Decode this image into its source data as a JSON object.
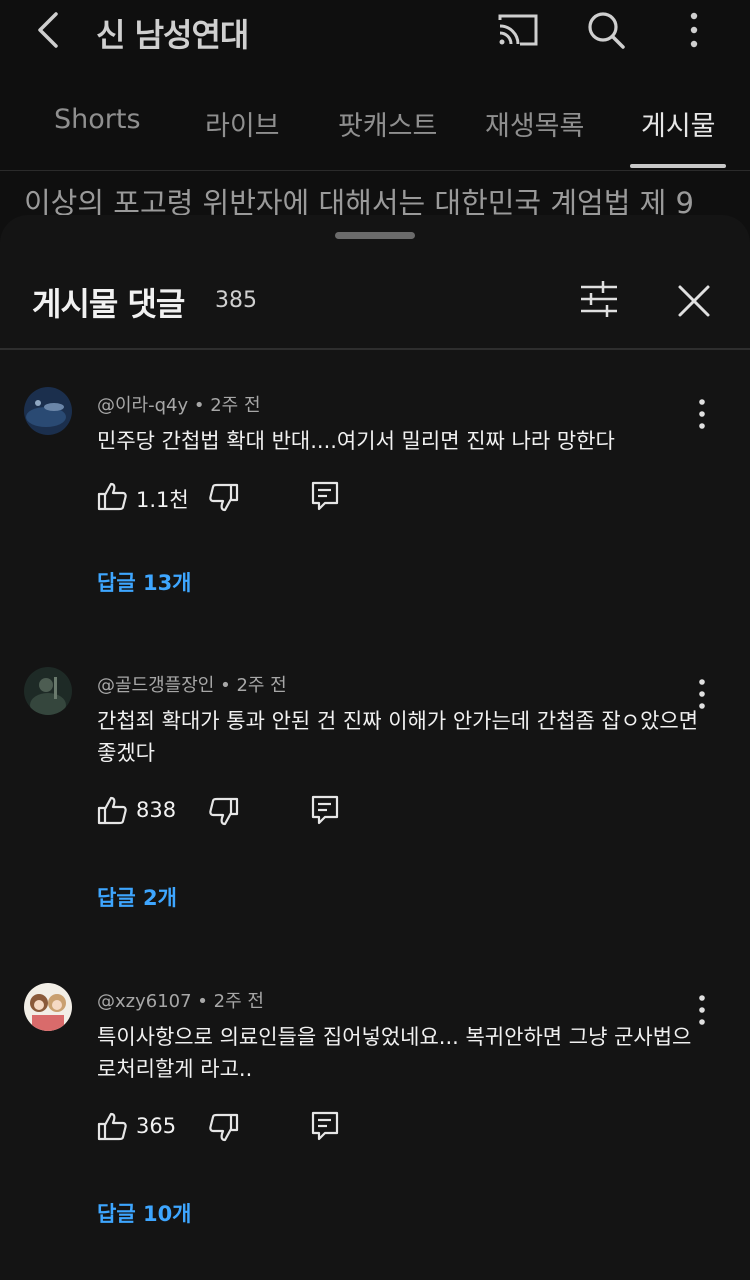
{
  "header": {
    "title": "신 남성연대",
    "icons": [
      "back-arrow-icon",
      "cast-icon",
      "search-icon",
      "more-vertical-icon"
    ]
  },
  "tabs": [
    {
      "label": "Shorts",
      "active": false
    },
    {
      "label": "라이브",
      "active": false
    },
    {
      "label": "팟캐스트",
      "active": false
    },
    {
      "label": "재생목록",
      "active": false
    },
    {
      "label": "게시물",
      "active": true
    }
  ],
  "background_post_text": "이상의 포고령 위반자에 대해서는 대한민국 계엄법 제 9",
  "sheet": {
    "title": "게시물 댓글",
    "count": "385",
    "icons": [
      "sort-filter-icon",
      "close-icon"
    ]
  },
  "comments": [
    {
      "author": "@이라-q4y",
      "time": "2주 전",
      "text": "민주당 간첩법 확대 반대....여기서 밀리면 진짜 나라 망한다",
      "likes": "1.1천",
      "replies": "답글 13개"
    },
    {
      "author": "@골드갱플장인",
      "time": "2주 전",
      "text": "간첩죄 확대가 통과 안된 건 진짜 이해가 안가는데 간첩좀 잡ㅇ았으면 좋겠다",
      "likes": "838",
      "replies": "답글 2개"
    },
    {
      "author": "@xzy6107",
      "time": "2주 전",
      "text": "특이사항으로 의료인들을 집어넣었네요... 복귀안하면 그냥 군사법으로처리할게 라고..",
      "likes": "365",
      "replies": "답글 10개"
    }
  ],
  "colors": {
    "background": "#0f0f0f",
    "sheet": "#141414",
    "link": "#3ea6ff",
    "secondary_text": "#a7a7a7"
  }
}
